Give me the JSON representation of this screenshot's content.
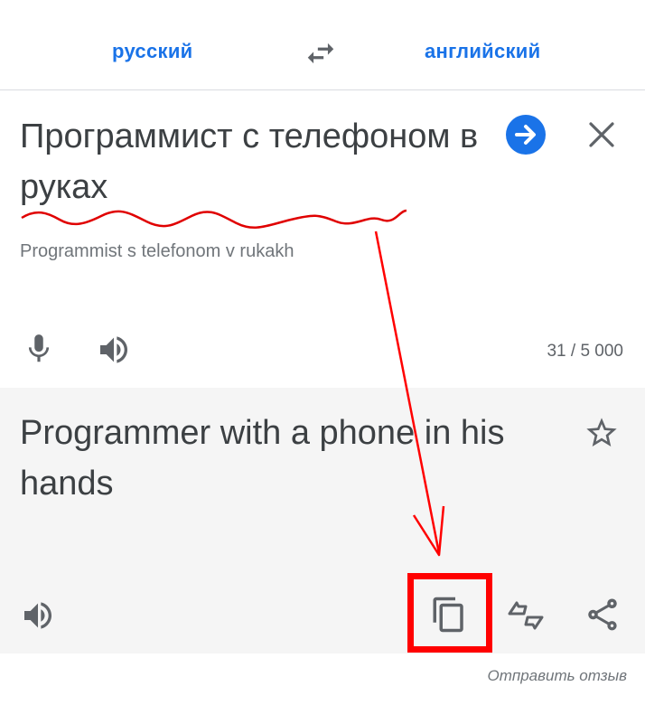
{
  "languages": {
    "source": "русский",
    "target": "английский"
  },
  "input": {
    "text": "Программист с телефоном в руках",
    "transliteration": "Programmist s telefonom v rukakh",
    "char_count": "31 / 5 000"
  },
  "output": {
    "text": "Programmer with a phone in his hands"
  },
  "footer": {
    "send_feedback": "Отправить отзыв"
  },
  "icons": {
    "swap": "swap-arrows-icon",
    "go": "arrow-right-icon",
    "clear": "close-icon",
    "mic": "mic-icon",
    "speaker": "speaker-icon",
    "star": "star-icon",
    "copy": "copy-icon",
    "feedback": "feedback-icon",
    "share": "share-icon"
  },
  "colors": {
    "accent": "#1a73e8",
    "annotation": "#ff0000",
    "output_bg": "#f5f5f5"
  }
}
